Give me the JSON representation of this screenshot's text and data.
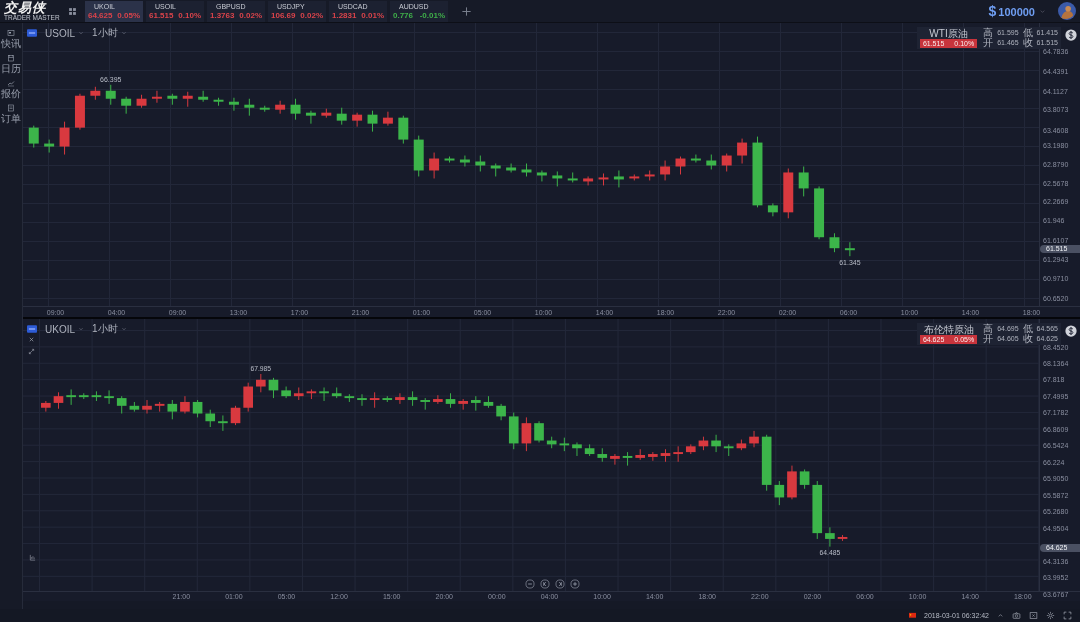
{
  "app": {
    "logo": "交易侠",
    "logo_subtitle": "TRADER MASTER"
  },
  "tickers": [
    {
      "symbol": "UKOIL",
      "price": "64.625",
      "change": "0.05%",
      "color": "#d9434a",
      "selected": true
    },
    {
      "symbol": "USOIL",
      "price": "61.515",
      "change": "0.10%",
      "color": "#d9434a",
      "selected": false
    },
    {
      "symbol": "GBPUSD",
      "price": "1.3763",
      "change": "0.02%",
      "color": "#d9434a",
      "selected": false
    },
    {
      "symbol": "USDJPY",
      "price": "106.69",
      "change": "0.02%",
      "color": "#d9434a",
      "selected": false
    },
    {
      "symbol": "USDCAD",
      "price": "1.2831",
      "change": "0.01%",
      "color": "#d9434a",
      "selected": false
    },
    {
      "symbol": "AUDUSD",
      "price": "0.776",
      "change": "-0.01%",
      "color": "#3fae49",
      "selected": false
    }
  ],
  "account": {
    "currency": "$",
    "balance": "100000"
  },
  "sidebar": {
    "items": [
      {
        "kind": "news",
        "label": "快讯"
      },
      {
        "kind": "calendar",
        "label": "日历"
      },
      {
        "kind": "quotes",
        "label": "报价"
      },
      {
        "kind": "orders",
        "label": "订单"
      }
    ]
  },
  "charts": [
    {
      "symbol": "USOIL",
      "interval": "1小时",
      "info": {
        "name": "WTI原油",
        "price": "61.515",
        "change": "0.10%",
        "high_label": "高",
        "high": "61.595",
        "low_label": "低",
        "low": "61.415",
        "open_label": "开",
        "open": "61.465",
        "close_label": "收",
        "close": "61.515"
      },
      "y_labels": [
        "64.7836",
        "64.4391",
        "64.1127",
        "63.8073",
        "63.4608",
        "63.1980",
        "62.8790",
        "62.5678",
        "62.2669",
        "61.946",
        "61.6107",
        "61.2943",
        "60.9710",
        "60.6520"
      ],
      "x_labels": [
        "09:00",
        "04:00",
        "09:00",
        "13:00",
        "17:00",
        "21:00",
        "01:00",
        "05:00",
        "10:00",
        "14:00",
        "18:00",
        "22:00",
        "02:00",
        "06:00",
        "10:00",
        "14:00",
        "18:00"
      ],
      "current_price": "61.515",
      "high_marker": "66.395",
      "low_marker": "61.345"
    },
    {
      "symbol": "UKOIL",
      "interval": "1小时",
      "info": {
        "name": "布伦特原油",
        "price": "64.625",
        "change": "0.05%",
        "high_label": "高",
        "high": "64.695",
        "low_label": "低",
        "low": "64.565",
        "open_label": "开",
        "open": "64.605",
        "close_label": "收",
        "close": "64.625"
      },
      "y_labels": [
        "68.4520",
        "68.1364",
        "67.818",
        "67.4995",
        "67.1782",
        "66.8609",
        "66.5424",
        "66.224",
        "65.9050",
        "65.5872",
        "65.2680",
        "64.9504",
        "64.3136",
        "63.9952",
        "63.6767"
      ],
      "x_labels": [
        "21:00",
        "01:00",
        "05:00",
        "12:00",
        "15:00",
        "20:00",
        "00:00",
        "04:00",
        "10:00",
        "14:00",
        "18:00",
        "22:00",
        "02:00",
        "06:00",
        "10:00",
        "14:00",
        "18:00"
      ],
      "current_price": "64.625",
      "high_marker": "67.985",
      "low_marker": "64.485",
      "side_tools": [
        {
          "kind": "close"
        },
        {
          "kind": "expand"
        }
      ],
      "bottom_tools": [
        {
          "kind": "indicators"
        }
      ],
      "zoom_controls": [
        {
          "kind": "zoom-out"
        },
        {
          "kind": "scroll-left"
        },
        {
          "kind": "scroll-right"
        },
        {
          "kind": "zoom-in"
        }
      ]
    }
  ],
  "status_bar": {
    "datetime": "2018-03-01 06:32:42",
    "tools": [
      {
        "kind": "camera"
      },
      {
        "kind": "window"
      },
      {
        "kind": "settings"
      },
      {
        "kind": "fullscreen"
      }
    ]
  }
}
